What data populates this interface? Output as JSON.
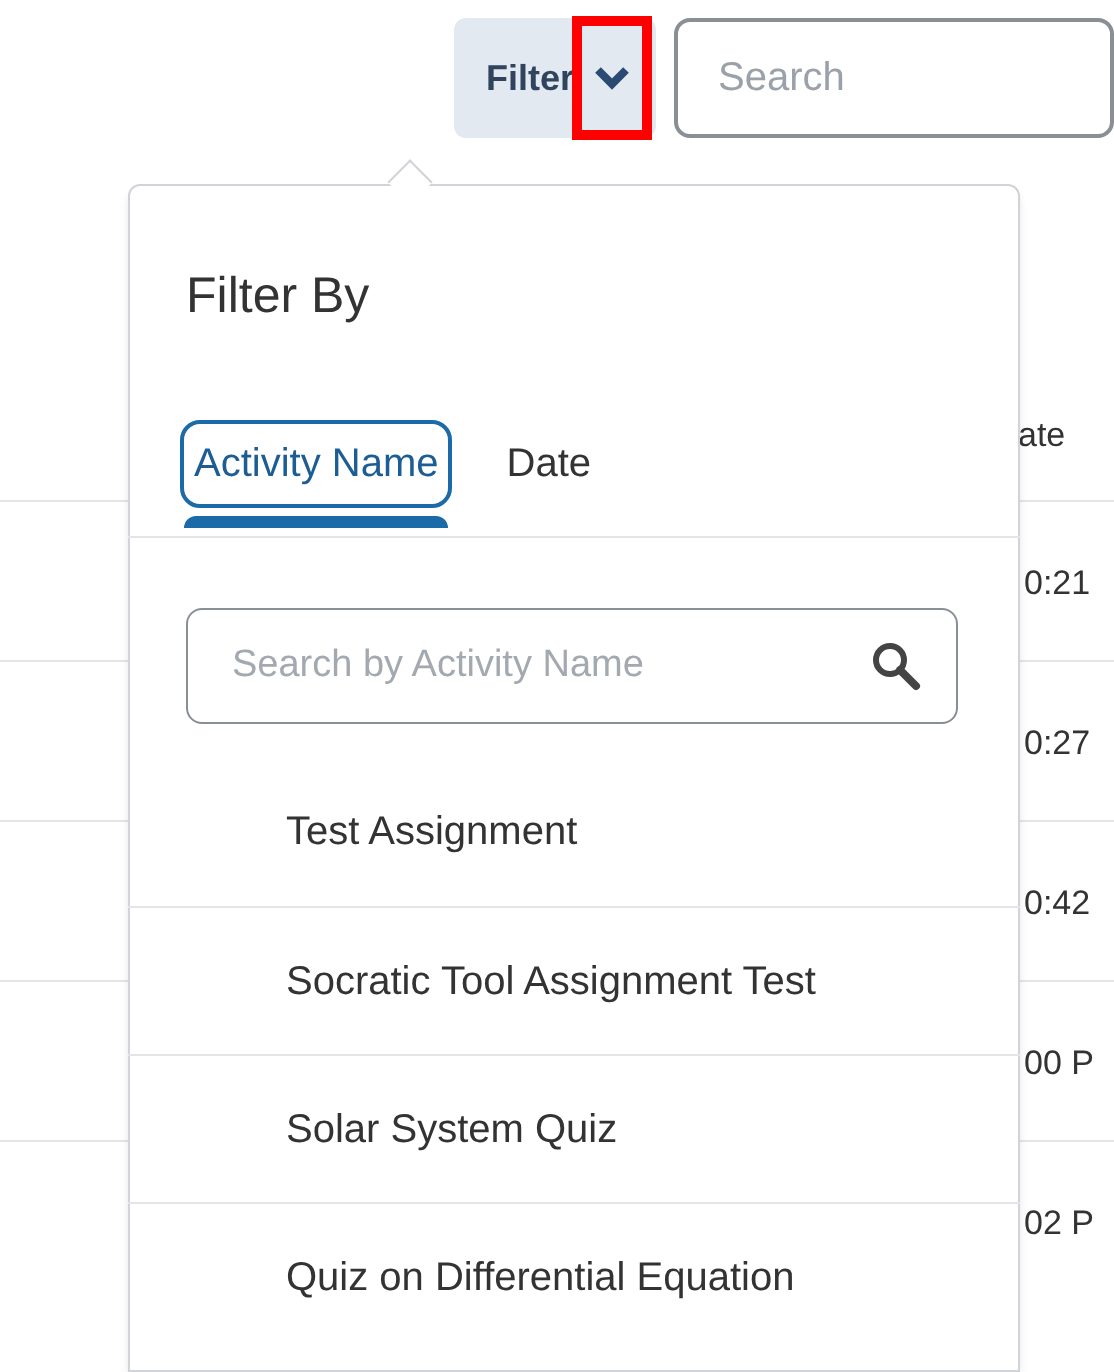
{
  "toolbar": {
    "filter_button": {
      "label": "Filter",
      "highlighted": true
    },
    "search": {
      "placeholder": "Search"
    }
  },
  "table": {
    "column_header": "ate",
    "rows": [
      "0:21",
      "0:27",
      "0:42",
      "00 P",
      "02 P"
    ]
  },
  "filter_popup": {
    "title": "Filter By",
    "tabs": [
      {
        "label": "Activity Name",
        "selected": true
      },
      {
        "label": "Date",
        "selected": false
      }
    ],
    "search": {
      "placeholder": "Search by Activity Name"
    },
    "options": [
      "Test Assignment",
      "Socratic Tool Assignment Test",
      "Solar System Quiz",
      "Quiz on Differential Equation"
    ]
  }
}
